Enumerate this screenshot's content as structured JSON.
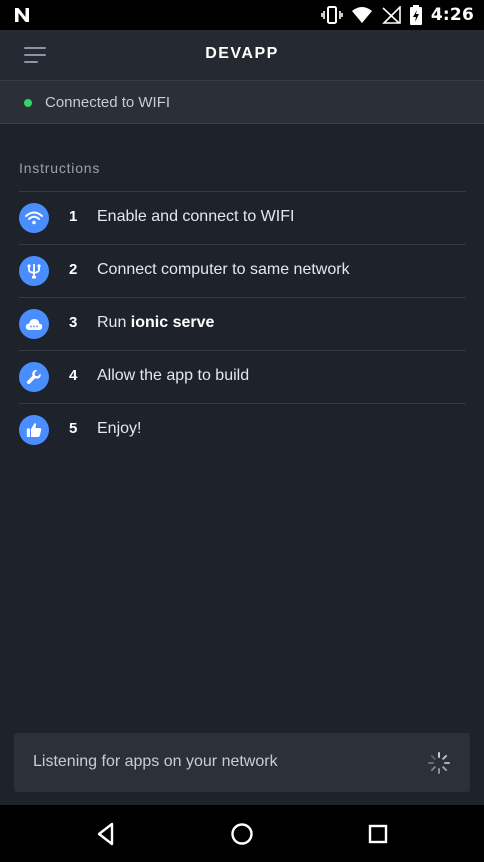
{
  "status_bar": {
    "time": "4:26",
    "left_icon": "n-notification-icon",
    "icons": [
      "vibrate-icon",
      "wifi-icon",
      "no-signal-icon",
      "battery-charging-icon"
    ]
  },
  "header": {
    "title": "DEVAPP",
    "menu_icon": "menu-icon"
  },
  "connection": {
    "status_text": "Connected to WIFI",
    "status_color": "#33d46a"
  },
  "instructions": {
    "title": "Instructions",
    "items": [
      {
        "num": "1",
        "text": "Enable and connect to WIFI",
        "icon": "wifi-icon"
      },
      {
        "num": "2",
        "text_prefix": "Connect computer to same network",
        "icon": "network-icon"
      },
      {
        "num": "3",
        "text_prefix": "Run ",
        "text_bold": "ionic serve",
        "icon": "cloud-icon"
      },
      {
        "num": "4",
        "text": "Allow the app to build",
        "icon": "wrench-icon"
      },
      {
        "num": "5",
        "text": "Enjoy!",
        "icon": "thumbs-up-icon"
      }
    ]
  },
  "listening": {
    "text": "Listening for apps on your network",
    "spinner_icon": "loading-spinner-icon"
  },
  "nav": {
    "back_icon": "back-icon",
    "home_icon": "home-icon",
    "recents_icon": "recents-icon"
  },
  "colors": {
    "background": "#1e222a",
    "accent": "#4a8dff"
  }
}
